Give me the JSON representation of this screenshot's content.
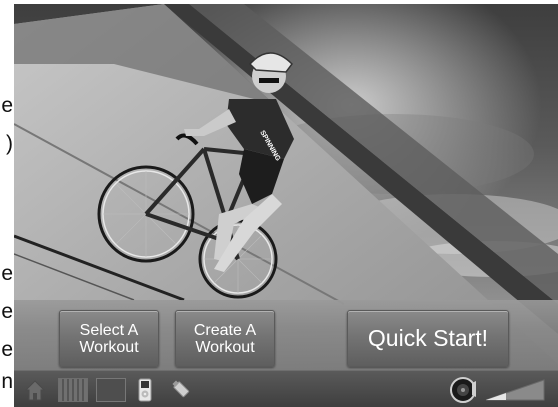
{
  "left_fragments": [
    "e",
    ")",
    "e",
    "e",
    "e",
    "n"
  ],
  "buttons": {
    "select_workout": "Select A Workout",
    "create_workout": "Create A Workout",
    "quick_start": "Quick Start!"
  },
  "taskbar": {
    "icons": [
      "home-icon",
      "equalizer-icon",
      "screen-icon",
      "ipod-icon",
      "usb-drive-icon",
      "volume-knob-icon",
      "volume-level-icon"
    ]
  },
  "colors": {
    "button_text": "#ffffff",
    "taskbar": "#4a4a4a"
  }
}
